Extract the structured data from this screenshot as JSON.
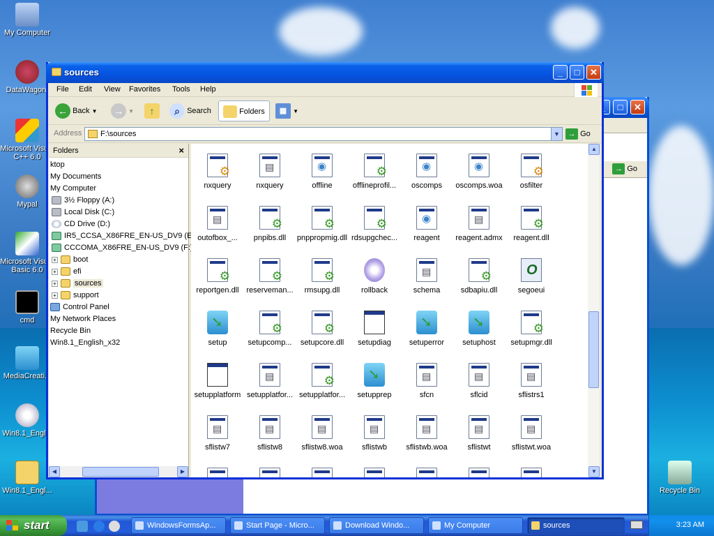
{
  "desktop": {
    "icons": [
      {
        "label": "My Computer"
      },
      {
        "label": "DataWagon."
      },
      {
        "label": "Microsoft Visual C++ 6.0"
      },
      {
        "label": "Mypal"
      },
      {
        "label": "Microsoft Visual Basic 6.0"
      },
      {
        "label": "cmd"
      },
      {
        "label": "MediaCreati..."
      },
      {
        "label": "Win8.1_Engl..."
      },
      {
        "label": "Win8.1_Engl..."
      },
      {
        "label": "Recycle Bin"
      }
    ]
  },
  "bg_window": {
    "go_label": "Go"
  },
  "window": {
    "title": "sources",
    "menu": [
      "File",
      "Edit",
      "View",
      "Favorites",
      "Tools",
      "Help"
    ],
    "toolbar": {
      "back": "Back",
      "search": "Search",
      "folders": "Folders"
    },
    "address": {
      "label": "Address",
      "value": "F:\\sources",
      "go": "Go"
    },
    "folders_pane": {
      "title": "Folders",
      "close": "×",
      "tree": [
        {
          "label": "ktop"
        },
        {
          "label": "My Documents"
        },
        {
          "label": "My Computer"
        },
        {
          "label": "3½ Floppy (A:)"
        },
        {
          "label": "Local Disk (C:)"
        },
        {
          "label": "CD Drive (D:)"
        },
        {
          "label": "IR5_CCSA_X86FRE_EN-US_DV9 (E:)"
        },
        {
          "label": "CCCOMA_X86FRE_EN-US_DV9 (F:)"
        },
        {
          "label": "boot"
        },
        {
          "label": "efi"
        },
        {
          "label": "sources"
        },
        {
          "label": "support"
        },
        {
          "label": "Control Panel"
        },
        {
          "label": "My Network Places"
        },
        {
          "label": "Recycle Bin"
        },
        {
          "label": "Win8.1_English_x32"
        }
      ]
    },
    "files": [
      {
        "name": "nxquery",
        "icon": "gear-doc"
      },
      {
        "name": "nxquery",
        "icon": "lines-doc"
      },
      {
        "name": "offline",
        "icon": "globe-doc"
      },
      {
        "name": "offlineprofil...",
        "icon": "gear-green-doc"
      },
      {
        "name": "oscomps",
        "icon": "globe-doc"
      },
      {
        "name": "oscomps.woa",
        "icon": "globe-doc"
      },
      {
        "name": "osfilter",
        "icon": "gear-doc"
      },
      {
        "name": "outofbox_...",
        "icon": "lines-doc"
      },
      {
        "name": "pnpibs.dll",
        "icon": "gear-green-doc"
      },
      {
        "name": "pnppropmig.dll",
        "icon": "gear-green-doc"
      },
      {
        "name": "rdsupgchec...",
        "icon": "gear-green-doc"
      },
      {
        "name": "reagent",
        "icon": "globe-doc"
      },
      {
        "name": "reagent.admx",
        "icon": "lines-doc"
      },
      {
        "name": "reagent.dll",
        "icon": "gear-green-doc"
      },
      {
        "name": "reportgen.dll",
        "icon": "gear-green-doc"
      },
      {
        "name": "reserveman...",
        "icon": "gear-green-doc"
      },
      {
        "name": "rmsupg.dll",
        "icon": "gear-green-doc"
      },
      {
        "name": "rollback",
        "icon": "rollback"
      },
      {
        "name": "schema",
        "icon": "lines-doc"
      },
      {
        "name": "sdbapiu.dll",
        "icon": "gear-green-doc"
      },
      {
        "name": "segoeui",
        "icon": "font"
      },
      {
        "name": "setup",
        "icon": "setup-arrow"
      },
      {
        "name": "setupcomp...",
        "icon": "gear-green-doc"
      },
      {
        "name": "setupcore.dll",
        "icon": "gear-green-doc"
      },
      {
        "name": "setupdiag",
        "icon": "app"
      },
      {
        "name": "setuperror",
        "icon": "setup-arrow"
      },
      {
        "name": "setuphost",
        "icon": "setup-arrow"
      },
      {
        "name": "setupmgr.dll",
        "icon": "gear-green-doc"
      },
      {
        "name": "setupplatform",
        "icon": "app"
      },
      {
        "name": "setupplatfor...",
        "icon": "lines-doc"
      },
      {
        "name": "setupplatfor...",
        "icon": "gear-green-doc"
      },
      {
        "name": "setupprep",
        "icon": "setup-arrow"
      },
      {
        "name": "sfcn",
        "icon": "lines-doc"
      },
      {
        "name": "sflcid",
        "icon": "lines-doc"
      },
      {
        "name": "sflistrs1",
        "icon": "lines-doc"
      },
      {
        "name": "sflistw7",
        "icon": "lines-doc"
      },
      {
        "name": "sflistw8",
        "icon": "lines-doc"
      },
      {
        "name": "sflistw8.woa",
        "icon": "lines-doc"
      },
      {
        "name": "sflistwb",
        "icon": "lines-doc"
      },
      {
        "name": "sflistwb.woa",
        "icon": "lines-doc"
      },
      {
        "name": "sflistwt",
        "icon": "lines-doc"
      },
      {
        "name": "sflistwt.woa",
        "icon": "lines-doc"
      }
    ]
  },
  "taskbar": {
    "start": "start",
    "tasks": [
      {
        "label": "WindowsFormsAp..."
      },
      {
        "label": "Start Page - Micro..."
      },
      {
        "label": "Download Windo..."
      },
      {
        "label": "My Computer"
      },
      {
        "label": "sources"
      }
    ],
    "clock": "3:23 AM"
  },
  "colors": {
    "title_blue": "#0553e0",
    "start_green": "#3a9a3a",
    "selection": "#316ac5"
  }
}
